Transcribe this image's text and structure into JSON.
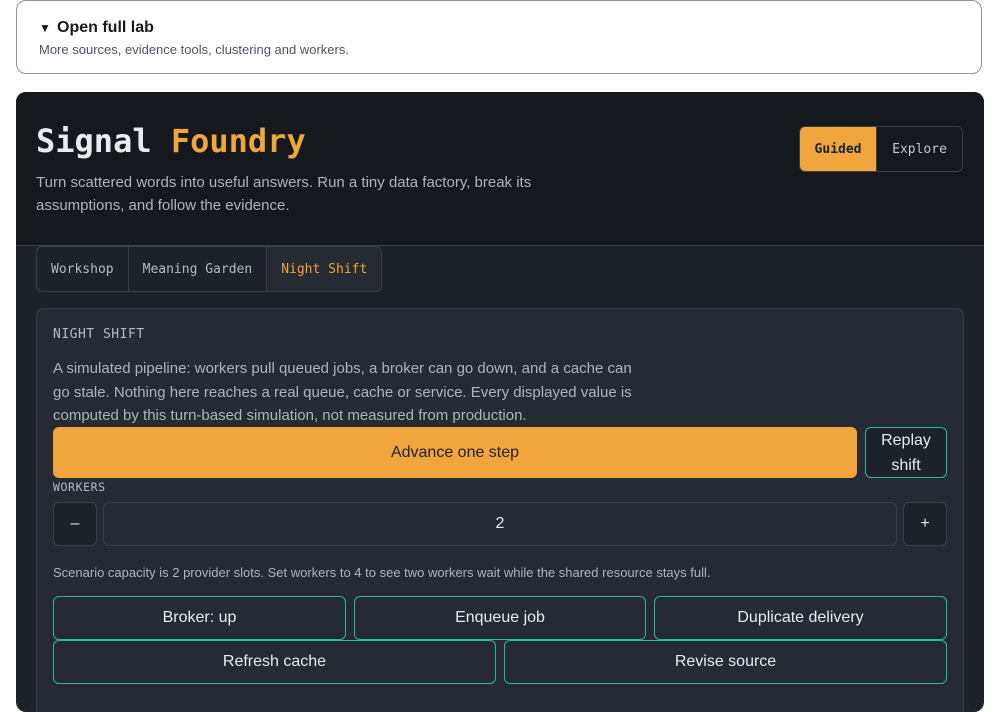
{
  "details": {
    "summary": "Open full lab",
    "marker": "▼",
    "hint": "More sources, evidence tools, clustering and workers."
  },
  "header": {
    "title_main": "Signal",
    "title_accent": "Foundry",
    "subtitle": "Turn scattered words into useful answers. Run a tiny data factory, break its assumptions, and follow the evidence.",
    "modes": {
      "guided": "Guided",
      "explore": "Explore",
      "selected": "Guided"
    }
  },
  "tabs": [
    {
      "label": "Workshop"
    },
    {
      "label": "Meaning Garden"
    },
    {
      "label": "Night Shift",
      "active": true
    }
  ],
  "night_shift": {
    "section_label": "NIGHT SHIFT",
    "description": "A simulated pipeline: workers pull queued jobs, a broker can go down, and a cache can go stale. Nothing here reaches a real queue, cache or service. Every displayed value is computed by this turn-based simulation, not measured from production.",
    "advance_label": "Advance one step",
    "replay_label": "Replay shift",
    "workers": {
      "label": "WORKERS",
      "value": "2",
      "decrement": "–",
      "increment": "+"
    },
    "capacity_note": "Scenario capacity is 2 provider slots. Set workers to 4 to see two workers wait while the shared resource stays full.",
    "actions": [
      "Broker: up",
      "Enqueue job",
      "Duplicate delivery",
      "Refresh cache",
      "Revise source"
    ]
  },
  "colors": {
    "accent": "#f0a53d",
    "teal_border": "#2fb7a3",
    "panel_bg": "#262b33",
    "app_bg": "#1d2128"
  }
}
